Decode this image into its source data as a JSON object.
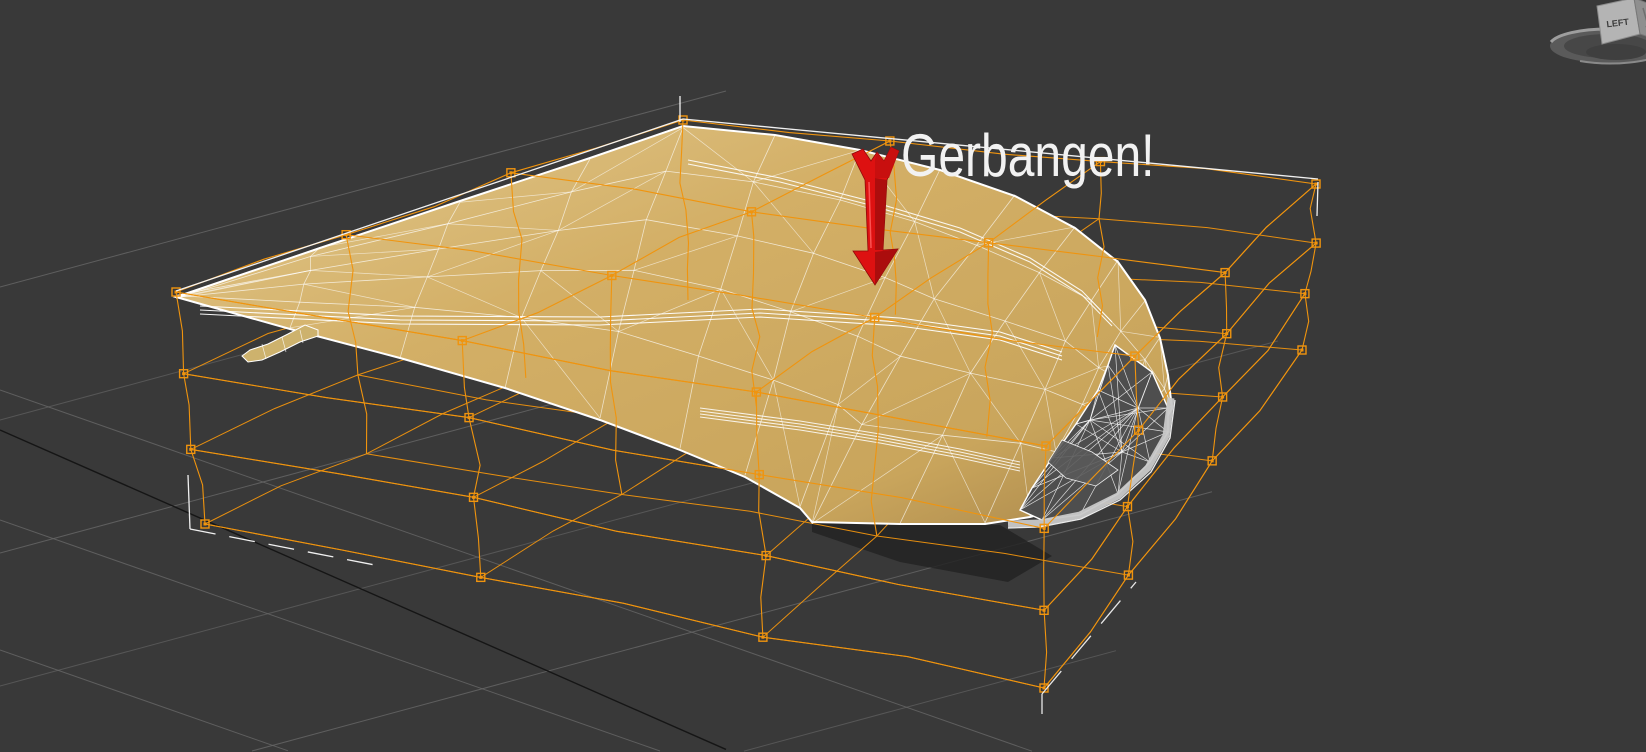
{
  "viewport": {
    "annotation": {
      "text": "Gerbangen!"
    },
    "viewcube": {
      "face_label": "LEFT"
    },
    "colors": {
      "background": "#393939",
      "grid_line": "#686868",
      "grid_axis": "#141414",
      "lattice": "#F0940E",
      "wireframe": "#FFFFFF",
      "hood_light": "#E2C98F",
      "hood_mid": "#D3AF66",
      "hood_dark": "#A9874B",
      "headlight": "#4E4E4E",
      "trim": "#C8C8C8",
      "selection_bracket": "#FAFAFA",
      "arrow": "#DD1111",
      "arrow_shadow": "#A50D0D",
      "annotation_text": "#F2F2F2",
      "shadow": "#232323",
      "viewcube_ring": "#6B6B6B",
      "viewcube_face": "#B4B4B4",
      "viewcube_side": "#8F8F8F"
    }
  }
}
